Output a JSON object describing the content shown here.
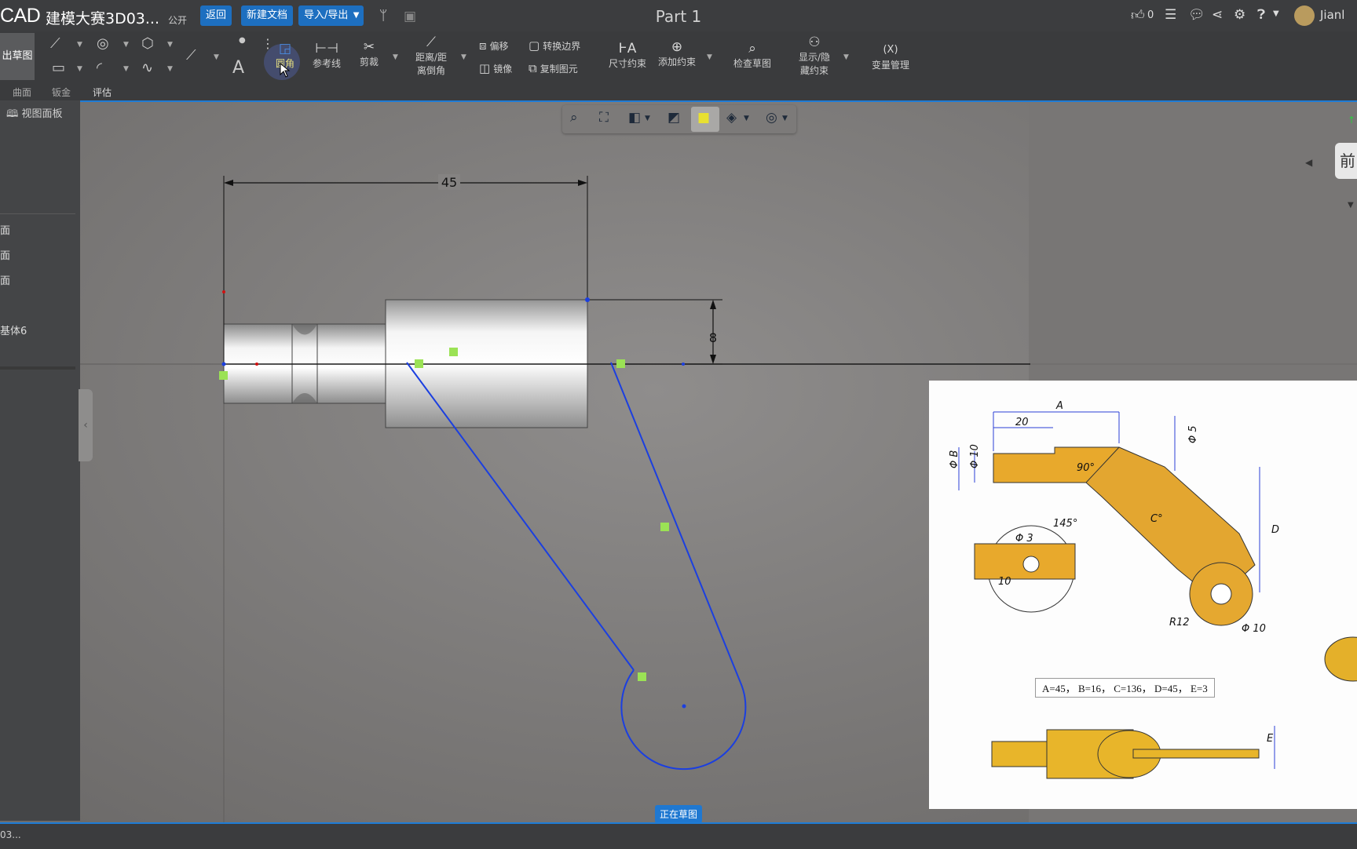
{
  "topbar": {
    "app_brand": "CAD",
    "doc_title": "建模大赛3D03...",
    "public_tag": "公开",
    "back_button": "返回",
    "new_doc_button": "新建文档",
    "import_export_button": "导入/导出",
    "part_title": "Part 1",
    "like_count": "0",
    "user_name": "Jianl"
  },
  "ribbon": {
    "exit_sketch": "出草图",
    "fillet": "圆角",
    "ref_line": "参考线",
    "trim": "剪裁",
    "chamfer_line1": "距离/距",
    "chamfer_line2": "离倒角",
    "offset": "偏移",
    "convert_boundary": "转换边界",
    "mirror": "镜像",
    "copy_element": "复制图元",
    "dim_constraint": "尺寸约束",
    "add_constraint": "添加约束",
    "check_sketch": "检查草图",
    "show_hide_line1": "显示/隐",
    "show_hide_line2": "藏约束",
    "var_mgmt_icon": "(X)",
    "var_mgmt": "变量管理"
  },
  "subtabs": [
    "曲面",
    "钣金",
    "评估"
  ],
  "left_panel": {
    "view_panel": "视图面板",
    "items": [
      "面",
      "面",
      "面",
      "基体6"
    ]
  },
  "view_cube_label": "前",
  "sketch": {
    "dim_width": "45",
    "dim_height": "8"
  },
  "reference": {
    "labels": [
      "A",
      "20",
      "Φ B",
      "Φ 10",
      "Φ 5",
      "90°",
      "145°",
      "C°",
      "D",
      "Φ 3",
      "10",
      "R12",
      "Φ 10",
      "E"
    ],
    "params": "A=45，  B=16，  C=136，  D=45，  E=3"
  },
  "status": {
    "sketching": "正在草图",
    "bottom_doc": "03..."
  }
}
